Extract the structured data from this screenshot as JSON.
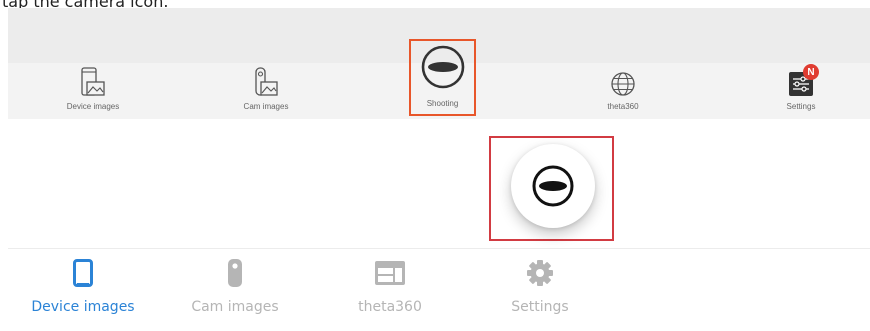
{
  "caption": "tap the camera icon.",
  "top_tabs": [
    {
      "label": "Device images",
      "icon": "device-images-icon"
    },
    {
      "label": "Cam images",
      "icon": "cam-images-icon"
    },
    {
      "label": "Shooting",
      "icon": "shutter-icon"
    },
    {
      "label": "theta360",
      "icon": "globe-icon"
    },
    {
      "label": "Settings",
      "icon": "settings-sliders-icon",
      "badge": "N"
    }
  ],
  "bottom_tabs": [
    {
      "label": "Device images",
      "icon": "smartphone-icon",
      "active": true
    },
    {
      "label": "Cam images",
      "icon": "camera-icon",
      "active": false
    },
    {
      "label": "theta360",
      "icon": "browser-window-icon",
      "active": false
    },
    {
      "label": "Settings",
      "icon": "gear-icon",
      "active": false
    }
  ],
  "colors": {
    "accent": "#2b83d6",
    "inactive": "#b5b5b5",
    "highlight_top": "#e8562a",
    "highlight_fab": "#d23b42",
    "badge": "#e03c31"
  }
}
